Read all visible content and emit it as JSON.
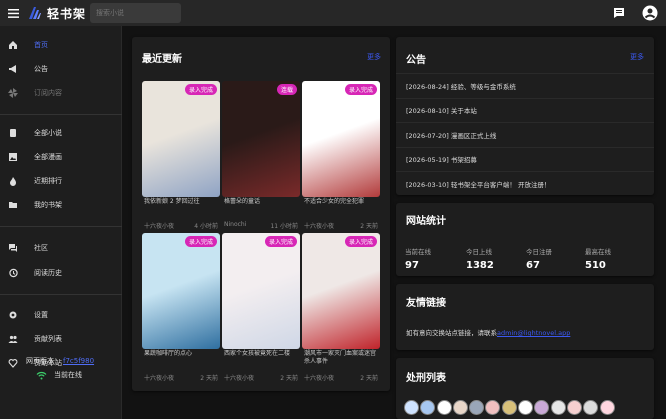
{
  "header": {
    "brand": "轻书架",
    "search_placeholder": "搜索小说"
  },
  "sidebar": {
    "items": [
      {
        "label": "首页",
        "icon": "home-icon"
      },
      {
        "label": "公告",
        "icon": "megaphone-icon"
      },
      {
        "label": "订阅内容",
        "icon": "pinwheel-icon"
      },
      {
        "label": "全部小说",
        "icon": "book-icon"
      },
      {
        "label": "全部漫画",
        "icon": "image-icon"
      },
      {
        "label": "近期排行",
        "icon": "fire-icon"
      },
      {
        "label": "我的书架",
        "icon": "folder-icon"
      },
      {
        "label": "社区",
        "icon": "forum-icon"
      },
      {
        "label": "阅读历史",
        "icon": "history-icon"
      },
      {
        "label": "设置",
        "icon": "gear-icon"
      },
      {
        "label": "贡献列表",
        "icon": "group-icon"
      },
      {
        "label": "赞助本站",
        "icon": "heart-icon"
      }
    ],
    "version_label": "网页版本：",
    "version_link": "f7c5f980",
    "online_label": "当前在线"
  },
  "recent": {
    "title": "最近更新",
    "more": "更多",
    "books": [
      {
        "title": "我依新娘 2 梦回过往",
        "author": "十六夜小夜",
        "time": "4 小时前",
        "badge": "录入完成",
        "c1": "#e9e4dc",
        "c2": "#8fa3c4"
      },
      {
        "title": "格蕾朵的童话",
        "author": "Ninochi",
        "time": "11 小时前",
        "badge": "连载",
        "c1": "#2a1a18",
        "c2": "#7a2a2a"
      },
      {
        "title": "不适合少女的完全犯罪",
        "author": "十六夜小夜",
        "time": "2 天前",
        "badge": "录入完成",
        "c1": "#ffffff",
        "c2": "#b23b3b"
      },
      {
        "title": "果蔬咖啡厅的点心",
        "author": "十六夜小夜",
        "time": "2 天前",
        "badge": "录入完成",
        "c1": "#c7e4f2",
        "c2": "#2f6fa0"
      },
      {
        "title": "西家个女孩被竟死在二楼",
        "author": "十六夜小夜",
        "time": "2 天前",
        "badge": "录入完成",
        "c1": "#f3eef0",
        "c2": "#cfd7e6"
      },
      {
        "title": "潮风市一家灭门血案或迷宫杀人事件",
        "author": "十六夜小夜",
        "time": "2 天前",
        "badge": "录入完成",
        "c1": "#efe8e6",
        "c2": "#c0232a"
      }
    ]
  },
  "notice": {
    "title": "公告",
    "more": "更多",
    "items": [
      "[2026-08-24] 经验、等级与金币系统",
      "[2026-08-10] 关于本站",
      "[2026-07-20] 漫画区正式上线",
      "[2026-05-19] 书架招募",
      "[2026-03-10] 轻书架全平台客户端！ 开放注册！"
    ]
  },
  "stats": {
    "title": "网站统计",
    "items": [
      {
        "label": "当前在线",
        "value": "97"
      },
      {
        "label": "今日上线",
        "value": "1382"
      },
      {
        "label": "今日注册",
        "value": "67"
      },
      {
        "label": "最高在线",
        "value": "510"
      }
    ]
  },
  "friends": {
    "title": "友情链接",
    "text": "如有意向交换站点链接，请联系",
    "email": "admin@lightnovel.app"
  },
  "punish": {
    "title": "处刑列表",
    "avatar_colors": [
      "#cfe3ff",
      "#a7c7f0",
      "#ffffff",
      "#e8d6c8",
      "#9aa6b8",
      "#f0c0c0",
      "#d8c07a",
      "#ffffff",
      "#c9a9d6",
      "#e6e6e6",
      "#f5d0d0",
      "#dcdcdc",
      "#ffd7e0"
    ]
  },
  "colors": {
    "accent": "#4f6df5",
    "badge": "#d726b6",
    "background": "#121212",
    "card": "#1e1e1e"
  }
}
